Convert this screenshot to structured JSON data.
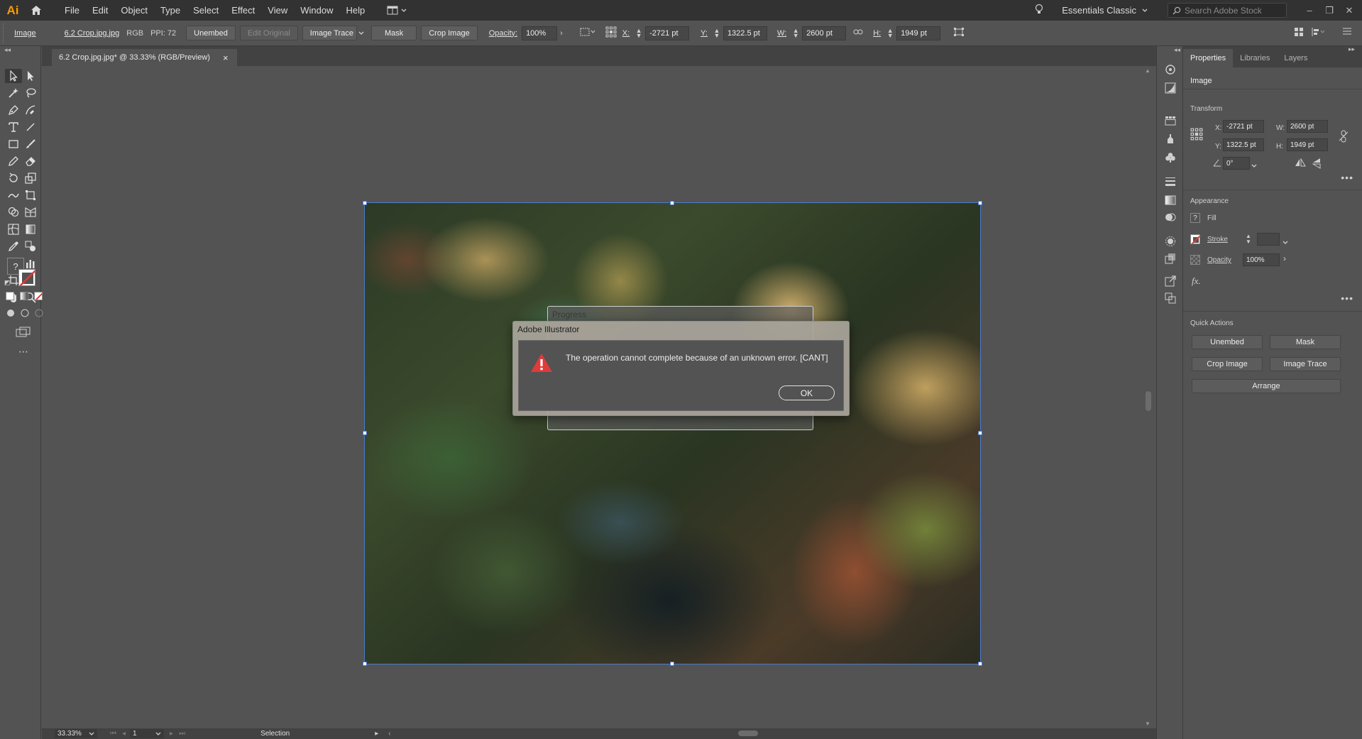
{
  "app": {
    "logo": "Ai"
  },
  "menu": [
    "File",
    "Edit",
    "Object",
    "Type",
    "Select",
    "Effect",
    "View",
    "Window",
    "Help"
  ],
  "workspace": "Essentials Classic",
  "stock_search": {
    "placeholder": "Search Adobe Stock"
  },
  "controlbar": {
    "object_type": "Image",
    "filename": "6.2 Crop.jpg.jpg",
    "color_mode": "RGB",
    "ppi": "PPI: 72",
    "unembed": "Unembed",
    "edit_original": "Edit Original",
    "image_trace": "Image Trace",
    "mask": "Mask",
    "crop_image": "Crop Image",
    "opacity_label": "Opacity:",
    "opacity_value": "100%",
    "x_label": "X:",
    "x_value": "-2721 pt",
    "y_label": "Y:",
    "y_value": "1322.5 pt",
    "w_label": "W:",
    "w_value": "2600 pt",
    "h_label": "H:",
    "h_value": "1949 pt"
  },
  "document_tab": {
    "title": "6.2 Crop.jpg.jpg* @ 33.33% (RGB/Preview)",
    "close": "×"
  },
  "progress_dialog": {
    "title": "Progress"
  },
  "error_dialog": {
    "title": "Adobe Illustrator",
    "message": "The operation cannot complete because of an unknown error.   [CANT]",
    "ok": "OK"
  },
  "statusbar": {
    "zoom": "33.33%",
    "page": "1",
    "tool": "Selection"
  },
  "properties": {
    "tabs": [
      "Properties",
      "Libraries",
      "Layers"
    ],
    "object_type": "Image",
    "transform_title": "Transform",
    "x_label": "X:",
    "x_value": "-2721 pt",
    "y_label": "Y:",
    "y_value": "1322.5 pt",
    "w_label": "W:",
    "w_value": "2600 pt",
    "h_label": "H:",
    "h_value": "1949 pt",
    "angle_value": "0°",
    "appearance_title": "Appearance",
    "fill_label": "Fill",
    "stroke_label": "Stroke",
    "opacity_label": "Opacity",
    "opacity_value": "100%",
    "fx_label": "fx.",
    "quick_actions_title": "Quick Actions",
    "qa_unembed": "Unembed",
    "qa_mask": "Mask",
    "qa_crop": "Crop Image",
    "qa_trace": "Image Trace",
    "qa_arrange": "Arrange"
  },
  "icons": {
    "home": "home-icon",
    "bulb": "lightbulb-icon",
    "search": "search-icon",
    "warning": "warning-icon",
    "fill_unknown": "question-icon"
  },
  "colors": {
    "accent_selection": "#4a7bd0",
    "logo": "#ff9a00",
    "warning": "#e03a3a"
  }
}
